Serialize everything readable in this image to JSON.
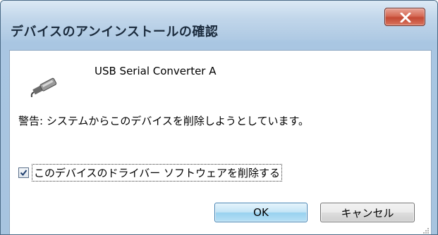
{
  "window": {
    "title": "デバイスのアンインストールの確認",
    "close_glyph": "X"
  },
  "device": {
    "name": "USB Serial Converter A",
    "icon": "usb-plug-icon"
  },
  "warning_text": "警告: システムからこのデバイスを削除しようとしています。",
  "option": {
    "label": "このデバイスのドライバー ソフトウェアを削除する",
    "checked": true
  },
  "buttons": {
    "ok_label": "OK",
    "cancel_label": "キャンセル"
  },
  "colors": {
    "frame": "#a9c6e2",
    "close_button": "#c44a35",
    "default_button": "#98d1ef"
  }
}
